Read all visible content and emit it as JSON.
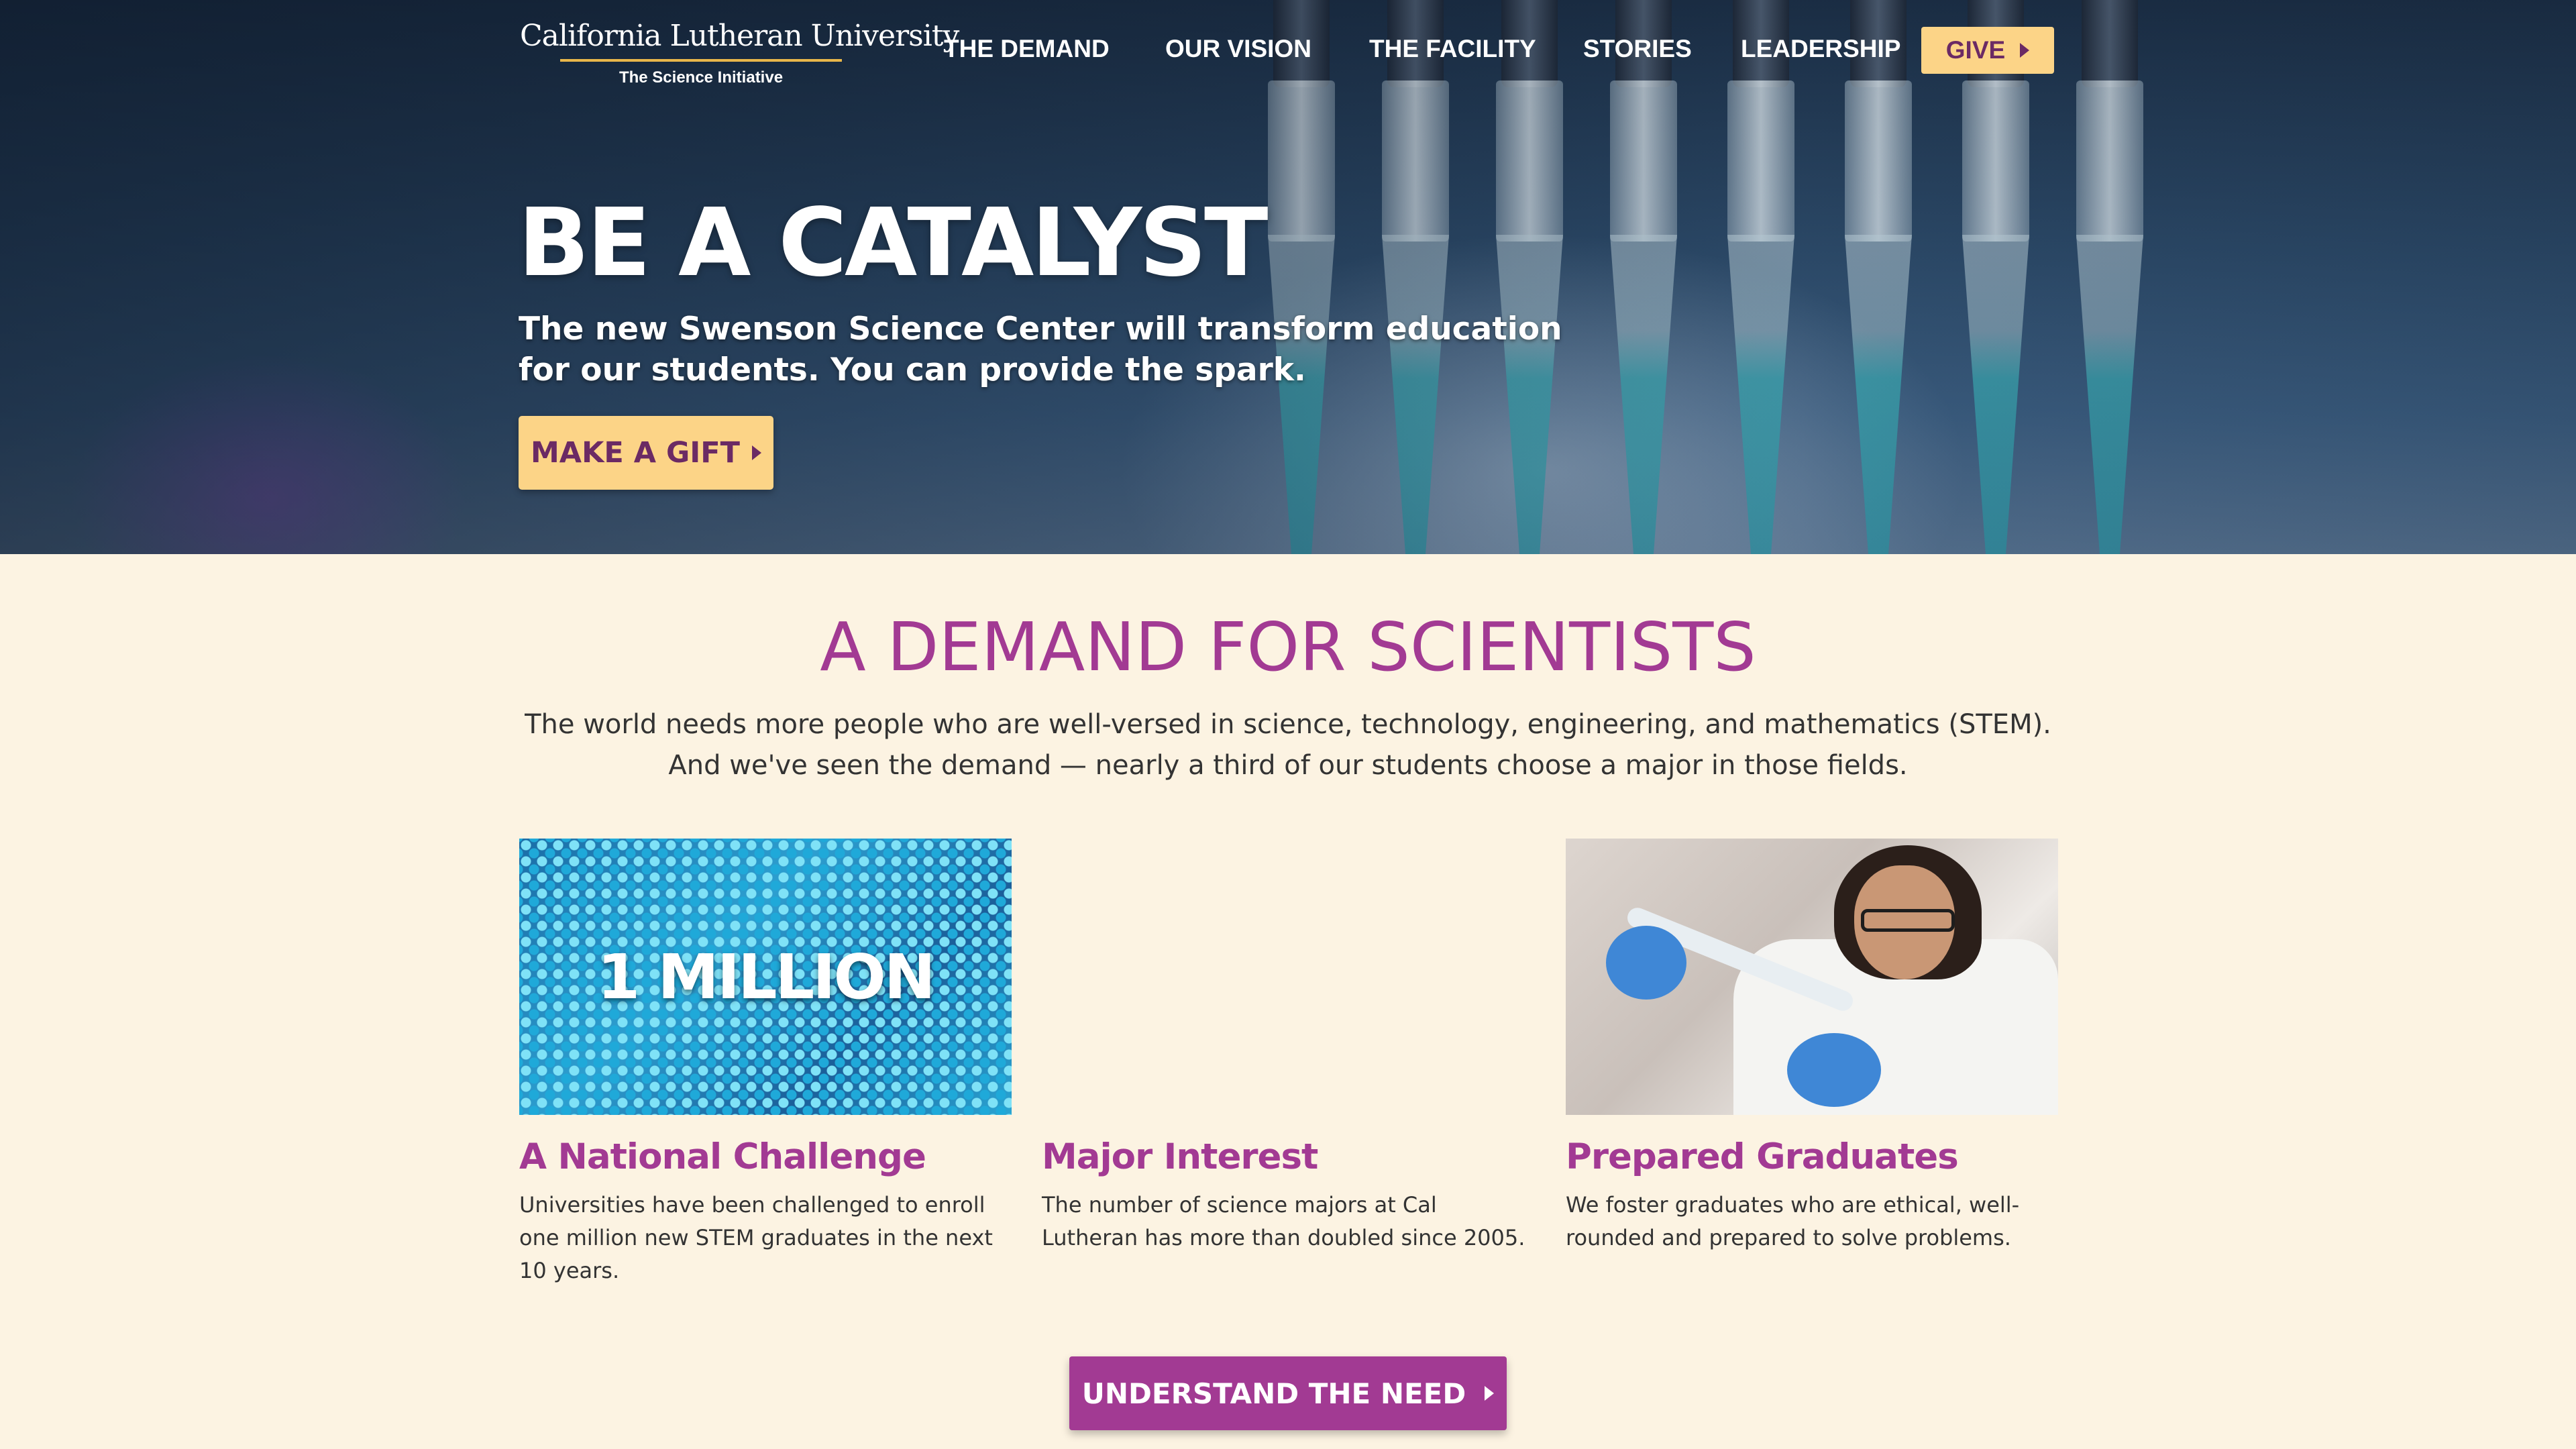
{
  "logo": {
    "name": "California Lutheran University",
    "subtitle": "The Science Initiative"
  },
  "nav": {
    "items": [
      "THE DEMAND",
      "OUR VISION",
      "THE FACILITY",
      "STORIES",
      "LEADERSHIP"
    ],
    "give_label": "GIVE"
  },
  "hero": {
    "title": "BE A CATALYST",
    "subtitle": "The new Swenson Science Center will transform education for our students. You can provide the spark.",
    "cta_label": "MAKE A GIFT"
  },
  "demand": {
    "title": "A DEMAND FOR SCIENTISTS",
    "intro_line1": "The world needs more people who are well-versed in science, technology, engineering, and mathematics (STEM).",
    "intro_line2": "And we've seen the demand — nearly a third of our students choose a major in those fields.",
    "cards": [
      {
        "image_text": "1 MILLION",
        "title": "A National Challenge",
        "text": "Universities have been challenged to enroll one million new STEM graduates in the next 10 years."
      },
      {
        "title": "Major Interest",
        "text": "The number of science majors at Cal Lutheran has more than doubled since 2005."
      },
      {
        "title": "Prepared Graduates",
        "text": "We foster graduates who are ethical, well-rounded and prepared to solve problems."
      }
    ],
    "cta_label": "UNDERSTAND THE NEED"
  },
  "colors": {
    "accent_purple": "#a23a93",
    "accent_gold": "#fcd487",
    "page_background": "#fcf3e2"
  }
}
